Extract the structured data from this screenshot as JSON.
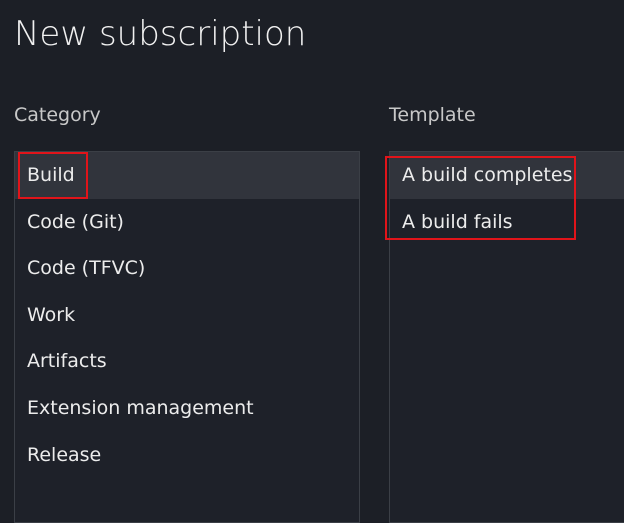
{
  "page": {
    "title": "New subscription"
  },
  "category": {
    "label": "Category",
    "items": [
      {
        "label": "Build",
        "selected": true
      },
      {
        "label": "Code (Git)",
        "selected": false
      },
      {
        "label": "Code (TFVC)",
        "selected": false
      },
      {
        "label": "Work",
        "selected": false
      },
      {
        "label": "Artifacts",
        "selected": false
      },
      {
        "label": "Extension management",
        "selected": false
      },
      {
        "label": "Release",
        "selected": false
      }
    ]
  },
  "template": {
    "label": "Template",
    "items": [
      {
        "label": "A build completes",
        "selected": true
      },
      {
        "label": "A build fails",
        "selected": false
      }
    ]
  },
  "colors": {
    "background": "#1c1f26",
    "panel_border": "#3b3f46",
    "selected_row": "#31343c",
    "highlight_box": "#e1141a"
  }
}
